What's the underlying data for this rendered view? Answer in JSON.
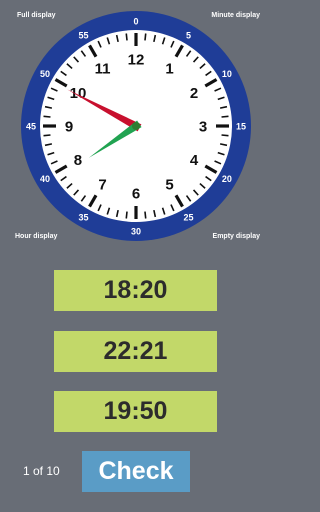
{
  "corners": {
    "top_left": "Full display",
    "top_right": "Minute display",
    "bottom_left": "Hour display",
    "bottom_right": "Empty display"
  },
  "clock": {
    "hour_numbers": [
      "12",
      "1",
      "2",
      "3",
      "4",
      "5",
      "6",
      "7",
      "8",
      "9",
      "10",
      "11"
    ],
    "minute_numbers": [
      "0",
      "5",
      "10",
      "15",
      "20",
      "25",
      "30",
      "35",
      "40",
      "45",
      "50",
      "55"
    ],
    "hands": {
      "hour_hand": "pointing near 8 (green)",
      "minute_hand": "pointing at 10 minute mark (red)"
    },
    "colors": {
      "ring": "#1f3d97",
      "face": "#ffffff",
      "hour_hand": "#21a351",
      "minute_hand": "#c8102e",
      "center": "#2e7d32"
    }
  },
  "answers": [
    "18:20",
    "22:21",
    "19:50"
  ],
  "progress": "1 of 10",
  "check_label": "Check",
  "colors": {
    "background": "#686d76",
    "answer_bg": "#c2d869",
    "check_bg": "#5a9cc6"
  }
}
